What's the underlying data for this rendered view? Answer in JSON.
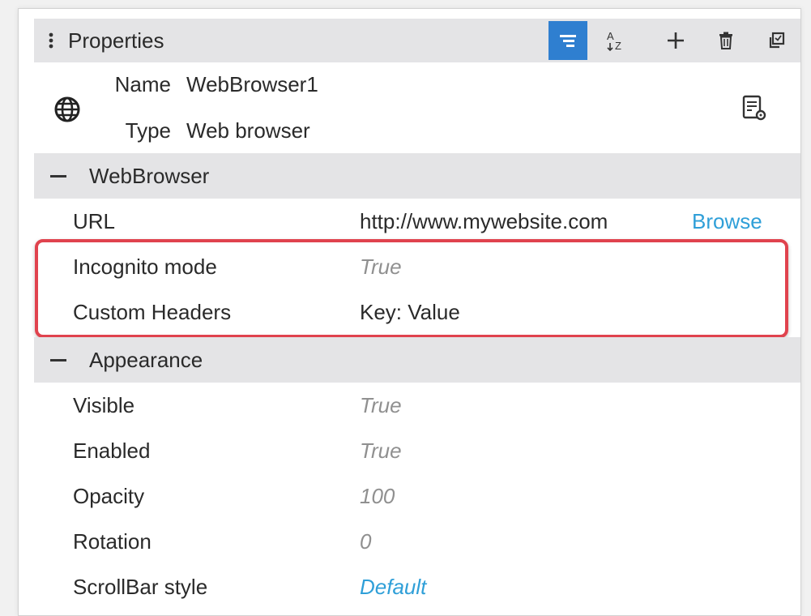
{
  "header": {
    "title": "Properties",
    "icons": [
      "categorize-icon",
      "sort-az-icon",
      "add-icon",
      "delete-icon",
      "copy-icon"
    ]
  },
  "info": {
    "name_label": "Name",
    "name_value": "WebBrowser1",
    "type_label": "Type",
    "type_value": "Web browser",
    "icon": "globe-icon",
    "action_icon": "properties-settings-icon"
  },
  "sections": {
    "webbrowser": {
      "title": "WebBrowser",
      "url_label": "URL",
      "url_value": "http://www.mywebsite.com",
      "browse_label": "Browse",
      "incognito_label": "Incognito mode",
      "incognito_value": "True",
      "headers_label": "Custom Headers",
      "headers_value": "Key: Value"
    },
    "appearance": {
      "title": "Appearance",
      "visible_label": "Visible",
      "visible_value": "True",
      "enabled_label": "Enabled",
      "enabled_value": "True",
      "opacity_label": "Opacity",
      "opacity_value": "100",
      "rotation_label": "Rotation",
      "rotation_value": "0",
      "scrollbar_label": "ScrollBar style",
      "scrollbar_value": "Default"
    }
  },
  "colors": {
    "accent": "#2f7fd0",
    "link": "#2f9fd8",
    "highlight": "#e0434e",
    "section_bg": "#e4e4e6"
  }
}
